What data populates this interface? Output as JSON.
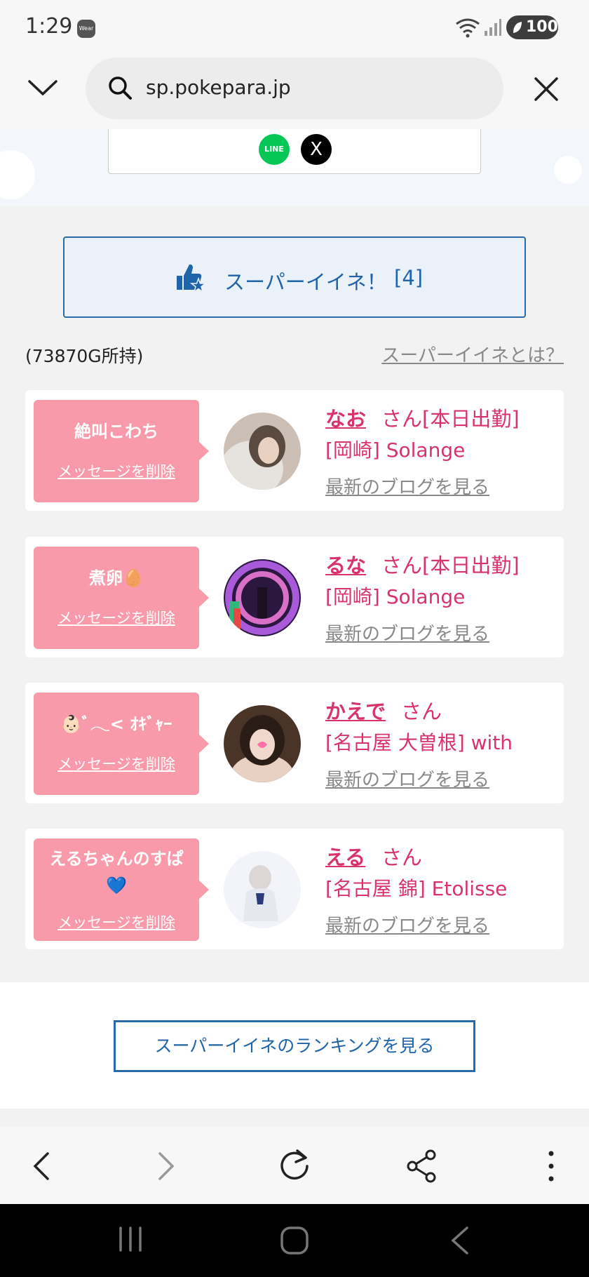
{
  "status": {
    "time": "1:29",
    "wear_badge": "Wear",
    "battery": "100"
  },
  "urlbar": {
    "url": "sp.pokepara.jp"
  },
  "share": {
    "line_label": "LINE",
    "x_label": "X"
  },
  "super_like": {
    "label": "スーパーイイネ！",
    "count": "[4]"
  },
  "points": "(73870G所持)",
  "what_link": "スーパーイイネとは？",
  "cards": [
    {
      "message_lines": [
        "絶叫こわち"
      ],
      "delete_label": "メッセージを削除",
      "name": "なお",
      "san": "さん[本日出勤]",
      "shop": "[岡崎] Solange",
      "blog": "最新のブログを見る"
    },
    {
      "message_lines": [
        "煮卵🥚"
      ],
      "delete_label": "メッセージを削除",
      "name": "るな",
      "san": "さん[本日出勤]",
      "shop": "[岡崎] Solange",
      "blog": "最新のブログを見る"
    },
    {
      "message_lines": [
        "👶🏻ﾞ𓂃< ｵｷﾞｬｰ"
      ],
      "delete_label": "メッセージを削除",
      "name": "かえで",
      "san": "さん",
      "shop": "[名古屋 大曽根] with",
      "blog": "最新のブログを見る"
    },
    {
      "message_lines": [
        "えるちゃんのすぱ",
        "💙"
      ],
      "delete_label": "メッセージを削除",
      "name": "える",
      "san": "さん",
      "shop": "[名古屋 錦] Etolisse",
      "blog": "最新のブログを見る"
    }
  ],
  "ranking_button": "スーパーイイネのランキングを見る",
  "colors": {
    "accent_blue": "#1f64a8",
    "pink_text": "#d8336a",
    "bubble_pink": "#f99aab"
  }
}
